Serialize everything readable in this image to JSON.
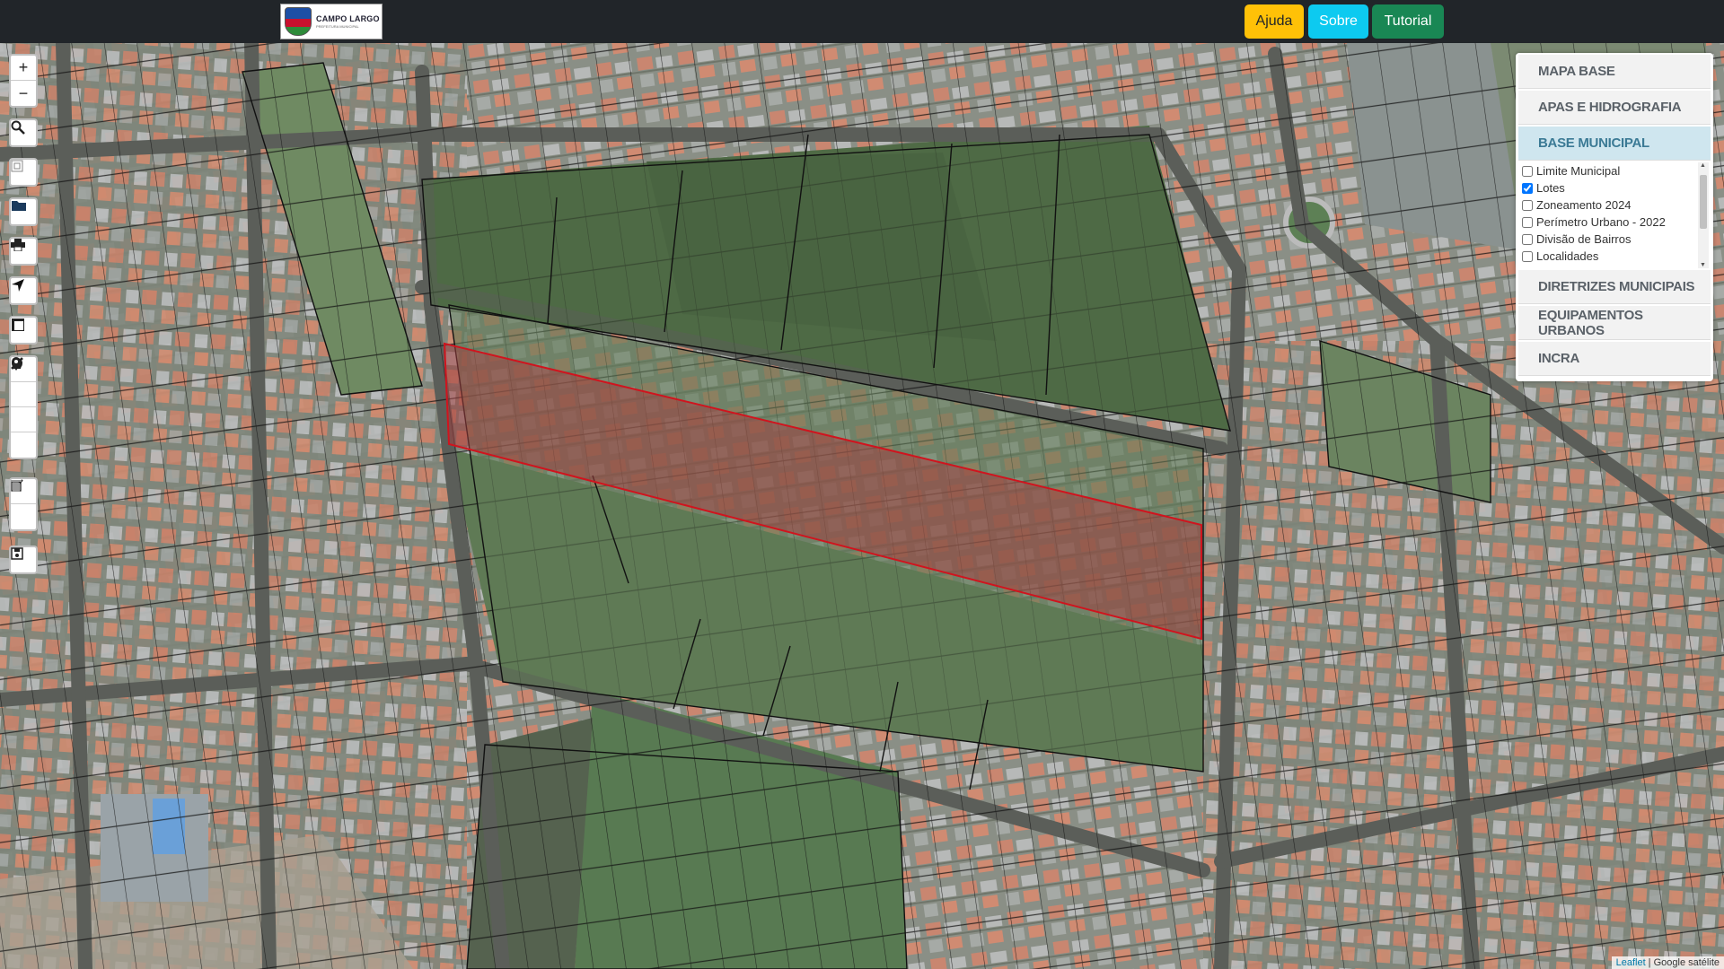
{
  "header": {
    "logo": {
      "name": "CAMPO LARGO",
      "subtitle": "PREFEITURA MUNICIPAL"
    },
    "buttons": {
      "help": "Ajuda",
      "about": "Sobre",
      "tutorial": "Tutorial"
    },
    "colors": {
      "help": "#ffc107",
      "about": "#0dcaf0",
      "tutorial": "#198754"
    }
  },
  "map_controls": {
    "zoom_in": "+",
    "zoom_out": "−",
    "icons": [
      "search-icon",
      "zoom-extent-icon",
      "open-folder-icon",
      "print-icon",
      "locate-arrow-icon",
      "basemap-frame-icon",
      "draw-line-icon",
      "draw-polygon-icon",
      "draw-circle-icon",
      "draw-marker-icon",
      "edit-icon",
      "trash-icon",
      "save-icon"
    ]
  },
  "layer_panel": {
    "sections": [
      {
        "label": "MAPA BASE"
      },
      {
        "label": "APAS E HIDROGRAFIA"
      },
      {
        "label": "BASE MUNICIPAL",
        "active": true
      },
      {
        "label": "DIRETRIZES MUNICIPAIS"
      },
      {
        "label": "EQUIPAMENTOS URBANOS"
      },
      {
        "label": "INCRA"
      }
    ],
    "layers": [
      {
        "label": "Limite Municipal",
        "checked": false
      },
      {
        "label": "Lotes",
        "checked": true
      },
      {
        "label": "Zoneamento 2024",
        "checked": false
      },
      {
        "label": "Perímetro Urbano - 2022",
        "checked": false
      },
      {
        "label": "Divisão de Bairros",
        "checked": false
      },
      {
        "label": "Localidades",
        "checked": false
      }
    ]
  },
  "attribution": {
    "leaflet": "Leaflet",
    "separator": " | ",
    "tiles": "Google satélite"
  },
  "highlight": {
    "stroke": "#d0141e",
    "fill": "#a04040"
  }
}
